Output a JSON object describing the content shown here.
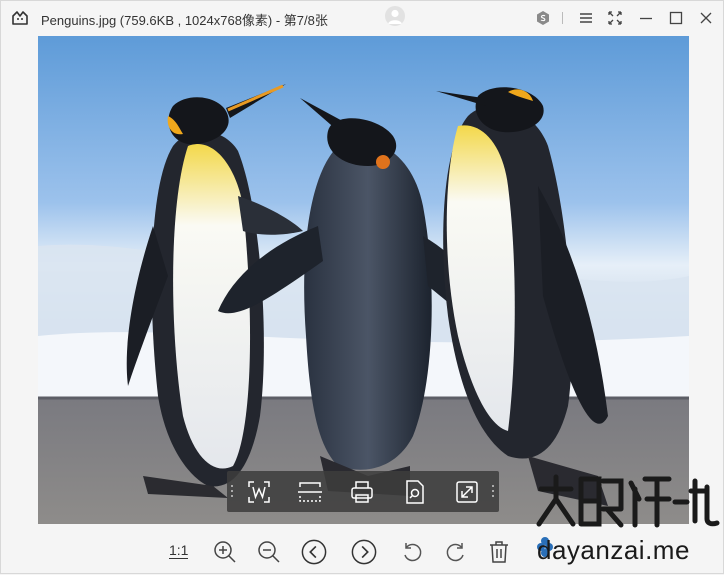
{
  "window": {
    "title": "Penguins.jpg (759.6KB , 1024x768像素) - 第7/8张"
  },
  "titlebar": {
    "icons": [
      "app-logo-icon",
      "user-avatar-icon",
      "hexagon-plugin-icon",
      "menu-icon",
      "fullscreen-icon",
      "minimize-icon",
      "maximize-icon",
      "close-icon"
    ]
  },
  "image": {
    "filename": "Penguins.jpg",
    "file_size": "759.6KB",
    "dimensions": "1024x768像素",
    "index": "第7/8张"
  },
  "float_toolbar": {
    "tools": [
      "word-extract-icon",
      "scan-icon",
      "print-icon",
      "ocr-search-icon",
      "open-external-icon"
    ]
  },
  "bottombar": {
    "ratio_label": "1:1",
    "tools": [
      "zoom-in-icon",
      "zoom-out-icon",
      "previous-icon",
      "next-icon",
      "rotate-left-icon",
      "rotate-right-icon",
      "delete-icon"
    ]
  },
  "watermark": {
    "text": "dayanzai.me",
    "logo_text": "大眼仔-旭"
  },
  "colors": {
    "background": "#f5f5f5",
    "toolbar_overlay": "#3c3c3c",
    "icon": "#555555"
  }
}
